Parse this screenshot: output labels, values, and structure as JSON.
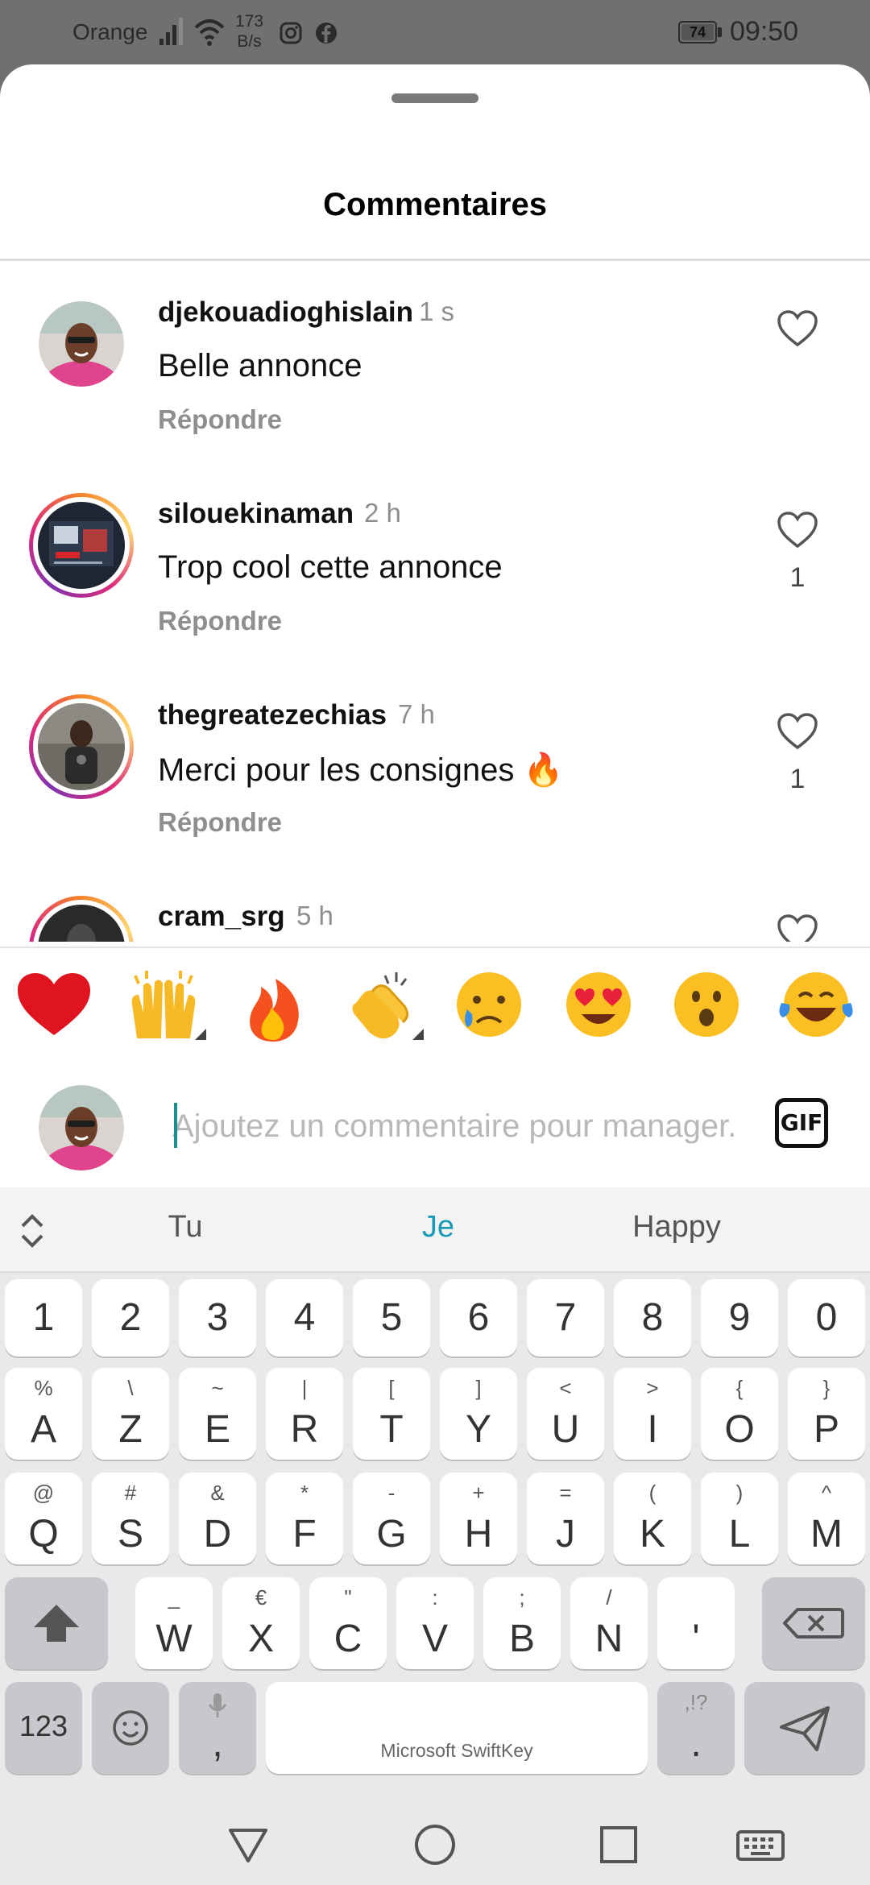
{
  "status_bar": {
    "carrier": "Orange",
    "net_speed_value": "173",
    "net_speed_unit": "B/s",
    "battery": "74",
    "time": "09:50"
  },
  "sheet": {
    "title": "Commentaires"
  },
  "comments": [
    {
      "username": "djekouadioghislain",
      "time": "1 s",
      "text": "Belle annonce",
      "reply": "Répondre",
      "likes": ""
    },
    {
      "username": "silouekinaman",
      "time": "2 h",
      "text": "Trop cool cette annonce",
      "reply": "Répondre",
      "likes": "1"
    },
    {
      "username": "thegreatezechias",
      "time": "7 h",
      "text": "Merci pour les consignes 🔥",
      "reply": "Répondre",
      "likes": "1"
    },
    {
      "username": "cram_srg",
      "time": "5 h",
      "text": "",
      "reply": "",
      "likes": ""
    }
  ],
  "emoji_bar": [
    "heart",
    "raising-hands",
    "fire",
    "clapping-hands",
    "crying-face",
    "heart-eyes",
    "surprised-face",
    "tears-of-joy"
  ],
  "comment_input": {
    "placeholder": "Ajoutez un commentaire pour manager...",
    "gif_label": "GIF"
  },
  "keyboard": {
    "suggestions": [
      "Tu",
      "Je",
      "Happy"
    ],
    "highlighted_suggestion": "Je",
    "highlight_color": "#1a9bb5",
    "number_row": [
      "1",
      "2",
      "3",
      "4",
      "5",
      "6",
      "7",
      "8",
      "9",
      "0"
    ],
    "row1": [
      {
        "key": "A",
        "alt": "%"
      },
      {
        "key": "Z",
        "alt": "\\"
      },
      {
        "key": "E",
        "alt": "~"
      },
      {
        "key": "R",
        "alt": "|"
      },
      {
        "key": "T",
        "alt": "["
      },
      {
        "key": "Y",
        "alt": "]"
      },
      {
        "key": "U",
        "alt": "<"
      },
      {
        "key": "I",
        "alt": ">"
      },
      {
        "key": "O",
        "alt": "{"
      },
      {
        "key": "P",
        "alt": "}"
      }
    ],
    "row2": [
      {
        "key": "Q",
        "alt": "@"
      },
      {
        "key": "S",
        "alt": "#"
      },
      {
        "key": "D",
        "alt": "&"
      },
      {
        "key": "F",
        "alt": "*"
      },
      {
        "key": "G",
        "alt": "-"
      },
      {
        "key": "H",
        "alt": "+"
      },
      {
        "key": "J",
        "alt": "="
      },
      {
        "key": "K",
        "alt": "("
      },
      {
        "key": "L",
        "alt": ")"
      },
      {
        "key": "M",
        "alt": "^"
      }
    ],
    "row3": [
      {
        "key": "W",
        "alt": "_"
      },
      {
        "key": "X",
        "alt": "€"
      },
      {
        "key": "C",
        "alt": "\""
      },
      {
        "key": "V",
        "alt": ":"
      },
      {
        "key": "B",
        "alt": ";"
      },
      {
        "key": "N",
        "alt": "/"
      },
      {
        "key": "'",
        "alt": ""
      }
    ],
    "symbols_key": "123",
    "comma_key": ",",
    "period_key": ".",
    "period_alt": ",!?",
    "space_label": "Microsoft SwiftKey"
  },
  "colors": {
    "story_ring": "#dd2a7b",
    "heart_red": "#e0141e",
    "accent": "#1a9bb5"
  }
}
